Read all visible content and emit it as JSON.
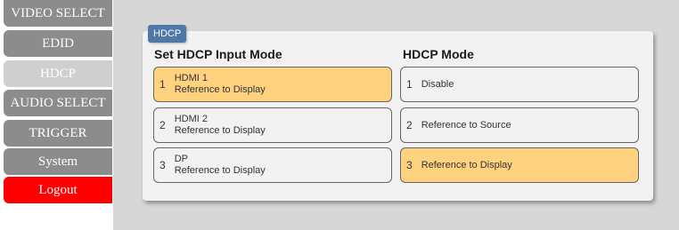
{
  "sidebar": {
    "items": [
      {
        "label": "VIDEO SELECT"
      },
      {
        "label": "EDID"
      },
      {
        "label": "HDCP"
      },
      {
        "label": "AUDIO SELECT"
      },
      {
        "label": "TRIGGER"
      },
      {
        "label": "System"
      },
      {
        "label": "Logout"
      }
    ],
    "active": "HDCP"
  },
  "panel": {
    "tag": "HDCP",
    "input_mode": {
      "title": "Set HDCP Input Mode",
      "options": [
        {
          "num": "1",
          "name": "HDMI 1",
          "mode": "Reference to Display",
          "selected": true
        },
        {
          "num": "2",
          "name": "HDMI 2",
          "mode": "Reference to Display",
          "selected": false
        },
        {
          "num": "3",
          "name": "DP",
          "mode": "Reference to Display",
          "selected": false
        }
      ]
    },
    "hdcp_mode": {
      "title": "HDCP Mode",
      "options": [
        {
          "num": "1",
          "label": "Disable",
          "selected": false
        },
        {
          "num": "2",
          "label": "Reference to Source",
          "selected": false
        },
        {
          "num": "3",
          "label": "Reference to Display",
          "selected": true
        }
      ]
    }
  },
  "colors": {
    "sidebar_bg": "#8c8c8c",
    "sidebar_active": "#cfcfcf",
    "logout": "#ff0000",
    "selected_option": "#ffd280",
    "tag_bg": "#4f78a8"
  }
}
